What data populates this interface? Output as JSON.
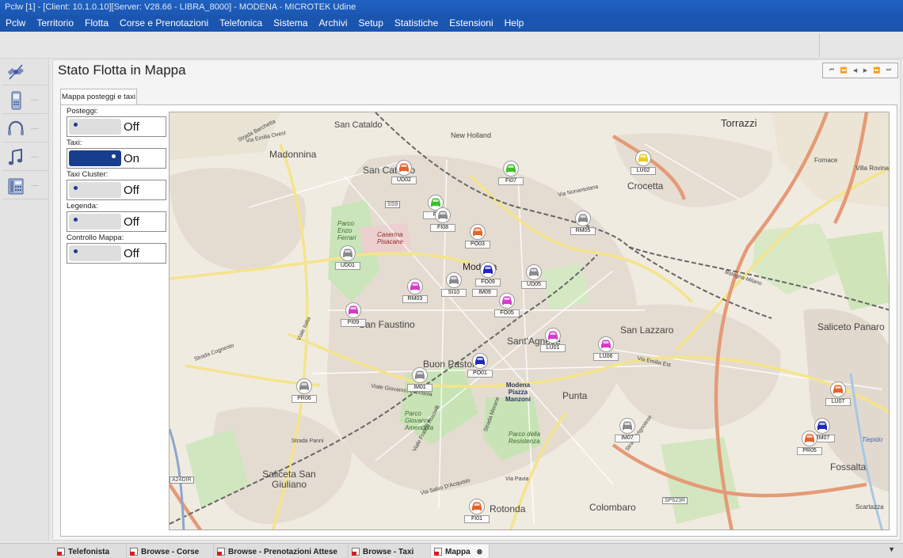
{
  "window": {
    "title": "Pclw [1] - [Client: 10.1.0.10][Server: V28.66 - LIBRA_8000] - MODENA - MICROTEK Udine"
  },
  "menu": [
    "Pclw",
    "Territorio",
    "Flotta",
    "Corse e Prenotazioni",
    "Telefonica",
    "Sistema",
    "Archivi",
    "Setup",
    "Statistiche",
    "Estensioni",
    "Help"
  ],
  "sidebar": {
    "icons": [
      "satellite-icon",
      "mobile-phone-icon",
      "headset-icon",
      "music-note-icon",
      "desk-phone-icon"
    ]
  },
  "page": {
    "title": "Stato Flotta in Mappa",
    "pager": [
      "⏮",
      "⏪",
      "◀",
      "▶",
      "⏩",
      "⏭"
    ],
    "tab": "Mappa posteggi e taxi"
  },
  "controls": [
    {
      "label": "Posteggi:",
      "state": "Off",
      "on": false
    },
    {
      "label": "Taxi:",
      "state": "On",
      "on": true
    },
    {
      "label": "Taxi Cluster:",
      "state": "Off",
      "on": false
    },
    {
      "label": "Legenda:",
      "state": "Off",
      "on": false
    },
    {
      "label": "Controllo Mappa:",
      "state": "Off",
      "on": false
    }
  ],
  "map_labels": [
    "San Cataldo",
    "Torrazzi",
    "Madonnina",
    "New Holland",
    "Crocetta",
    "Fornace",
    "Villa Rovina",
    "San Cataldo",
    "Modena",
    "Parco Enzo Ferrari",
    "Caserma Pisacane",
    "San Faustino",
    "Sant'Agnese",
    "San Lazzaro",
    "Saliceto Panaro",
    "Buon Pastore",
    "Modena Piazza Manzoni",
    "Punta",
    "Parco Giovanni Amendola",
    "Parco della Resistenza",
    "Saliceta San Giuliano",
    "Rotonda",
    "Colombaro",
    "Fossalta",
    "Scartazza",
    "Tiepido",
    "Strada Barchetta",
    "Via Emilia Ovest",
    "Via Emilia Est",
    "Viale Italia",
    "Strada Cognento",
    "Viale Giovanni Amendola",
    "Via Nonantolana",
    "Bologna-Milano",
    "Strada Panni",
    "Via Salvo D'Acquisto",
    "Via Pavia",
    "Strada Morane",
    "Viale Fratelli Rosselli",
    "Strada Vignolese",
    "SS9",
    "SP623R",
    "A24DIR"
  ],
  "taxis": [
    {
      "code": "UD02",
      "color": "#e8612a"
    },
    {
      "code": "FI07",
      "color": "#3bc12b"
    },
    {
      "code": "LU02",
      "color": "#e8cf1b"
    },
    {
      "code": "FI",
      "color": "#3bc12b"
    },
    {
      "code": "FI08",
      "color": "#8a8a8a"
    },
    {
      "code": "PO03",
      "color": "#e8612a"
    },
    {
      "code": "RM05",
      "color": "#8a8a8a"
    },
    {
      "code": "UD01",
      "color": "#8a8a8a"
    },
    {
      "code": "FO09",
      "color": "#2027b8"
    },
    {
      "code": "IM09",
      "color": "#8a8a8a"
    },
    {
      "code": "UD05",
      "color": "#8a8a8a"
    },
    {
      "code": "RM03",
      "color": "#d63ac8"
    },
    {
      "code": "SI10",
      "color": "#8a8a8a"
    },
    {
      "code": "FO05",
      "color": "#d63ac8"
    },
    {
      "code": "PI09",
      "color": "#d63ac8"
    },
    {
      "code": "LU01",
      "color": "#d63ac8"
    },
    {
      "code": "LU06",
      "color": "#d63ac8"
    },
    {
      "code": "PO01",
      "color": "#2027b8"
    },
    {
      "code": "IM01",
      "color": "#8a8a8a"
    },
    {
      "code": "PR06",
      "color": "#8a8a8a"
    },
    {
      "code": "LU07",
      "color": "#e8612a"
    },
    {
      "code": "IM07",
      "color": "#8a8a8a"
    },
    {
      "code": "RM07",
      "color": "#2027b8"
    },
    {
      "code": "PR05",
      "color": "#e8612a"
    },
    {
      "code": "FI01",
      "color": "#e8612a"
    }
  ],
  "bottom_tabs": [
    {
      "label": "Telefonista"
    },
    {
      "label": "Browse - Corse"
    },
    {
      "label": "Browse - Prenotazioni Attese"
    },
    {
      "label": "Browse - Taxi"
    },
    {
      "label": "Mappa"
    }
  ]
}
